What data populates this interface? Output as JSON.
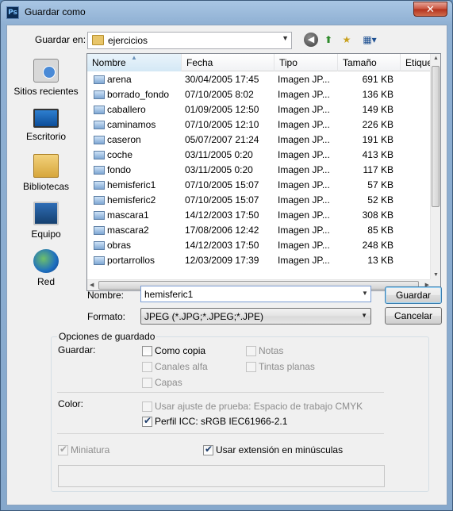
{
  "window": {
    "title": "Guardar como",
    "app_icon": "Ps",
    "close_glyph": "✕"
  },
  "toolbar": {
    "save_in_label": "Guardar en:",
    "folder": "ejercicios"
  },
  "places": [
    {
      "label": "Sitios recientes",
      "icon": "recent-places-icon"
    },
    {
      "label": "Escritorio",
      "icon": "desktop-icon"
    },
    {
      "label": "Bibliotecas",
      "icon": "libraries-icon"
    },
    {
      "label": "Equipo",
      "icon": "computer-icon"
    },
    {
      "label": "Red",
      "icon": "network-icon"
    }
  ],
  "list": {
    "columns": [
      "Nombre",
      "Fecha",
      "Tipo",
      "Tamaño",
      "Etique"
    ],
    "rows": [
      {
        "name": "arena",
        "date": "30/04/2005 17:45",
        "type": "Imagen JP...",
        "size": "691 KB"
      },
      {
        "name": "borrado_fondo",
        "date": "07/10/2005 8:02",
        "type": "Imagen JP...",
        "size": "136 KB"
      },
      {
        "name": "caballero",
        "date": "01/09/2005 12:50",
        "type": "Imagen JP...",
        "size": "149 KB"
      },
      {
        "name": "caminamos",
        "date": "07/10/2005 12:10",
        "type": "Imagen JP...",
        "size": "226 KB"
      },
      {
        "name": "caseron",
        "date": "05/07/2007 21:24",
        "type": "Imagen JP...",
        "size": "191 KB"
      },
      {
        "name": "coche",
        "date": "03/11/2005 0:20",
        "type": "Imagen JP...",
        "size": "413 KB"
      },
      {
        "name": "fondo",
        "date": "03/11/2005 0:20",
        "type": "Imagen JP...",
        "size": "117 KB"
      },
      {
        "name": "hemisferic1",
        "date": "07/10/2005 15:07",
        "type": "Imagen JP...",
        "size": "57 KB"
      },
      {
        "name": "hemisferic2",
        "date": "07/10/2005 15:07",
        "type": "Imagen JP...",
        "size": "52 KB"
      },
      {
        "name": "mascara1",
        "date": "14/12/2003 17:50",
        "type": "Imagen JP...",
        "size": "308 KB"
      },
      {
        "name": "mascara2",
        "date": "17/08/2006 12:42",
        "type": "Imagen JP...",
        "size": "85 KB"
      },
      {
        "name": "obras",
        "date": "14/12/2003 17:50",
        "type": "Imagen JP...",
        "size": "248 KB"
      },
      {
        "name": "portarrollos",
        "date": "12/03/2009 17:39",
        "type": "Imagen JP...",
        "size": "13 KB"
      }
    ]
  },
  "form": {
    "name_label": "Nombre:",
    "name_value": "hemisferic1",
    "format_label": "Formato:",
    "format_value": "JPEG (*.JPG;*.JPEG;*.JPE)",
    "save_button": "Guardar",
    "cancel_button": "Cancelar"
  },
  "options": {
    "title": "Opciones de guardado",
    "save_label": "Guardar:",
    "as_copy": "Como copia",
    "notes": "Notas",
    "alpha_channels": "Canales alfa",
    "spot_colors": "Tintas planas",
    "layers": "Capas",
    "color_label": "Color:",
    "proof_setup": "Usar ajuste de prueba: Espacio de trabajo CMYK",
    "icc_profile": "Perfil ICC: sRGB IEC61966-2.1",
    "thumbnail": "Miniatura",
    "lowercase_ext": "Usar extensión en minúsculas",
    "check_glyph": "✔"
  }
}
